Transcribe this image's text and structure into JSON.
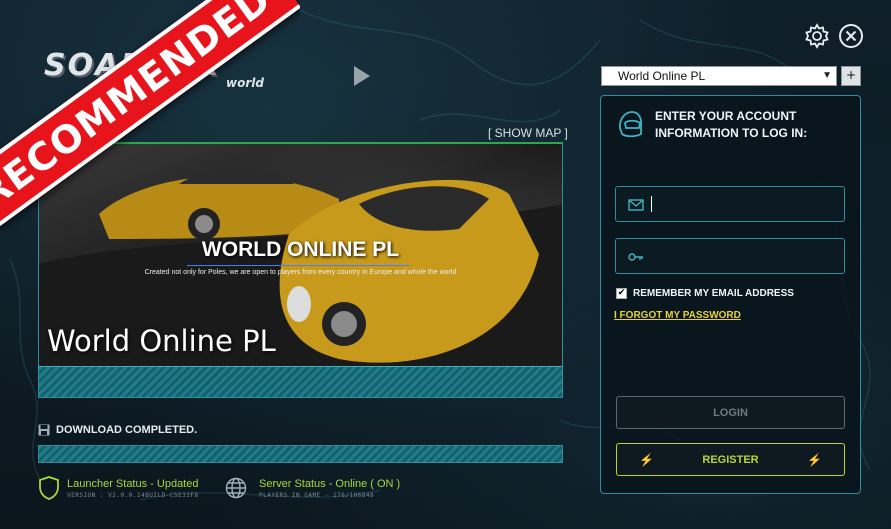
{
  "ribbon": {
    "text": "RECOMMENDED"
  },
  "logo": {
    "text": "SOAPBOX",
    "sub": "world"
  },
  "server": {
    "selected": "World Online PL",
    "add_label": "+"
  },
  "banner": {
    "show_map": "[ SHOW MAP ]",
    "heading": "WORLD ONLINE PL",
    "tagline": "Created not only for Poles, we are open to players from every country in Europe and whole the world",
    "title": "World Online PL"
  },
  "download": {
    "label": "DOWNLOAD COMPLETED.",
    "progress": 1.0
  },
  "launcher_status": {
    "title": "Launcher Status - Updated",
    "sub": "VERSION : V2.0.0.14BUILD-C5E33F8"
  },
  "server_status": {
    "title": "Server Status - Online ( ON )",
    "sub": "PLAYERS IN GAME - 176/106848"
  },
  "login": {
    "heading": "ENTER YOUR ACCOUNT INFORMATION TO LOG IN:",
    "email_value": "",
    "password_value": "",
    "remember_label": "REMEMBER MY EMAIL ADDRESS",
    "remember_checked": "✔",
    "forgot_label": "I FORGOT MY PASSWORD",
    "login_label": "LOGIN",
    "register_label": "REGISTER",
    "bolt": "⚡"
  },
  "colors": {
    "accent": "#2f8f9c",
    "status_green": "#a8d83a",
    "register": "#b9d530",
    "forgot": "#e8d13a",
    "ribbon": "#e8141b"
  }
}
